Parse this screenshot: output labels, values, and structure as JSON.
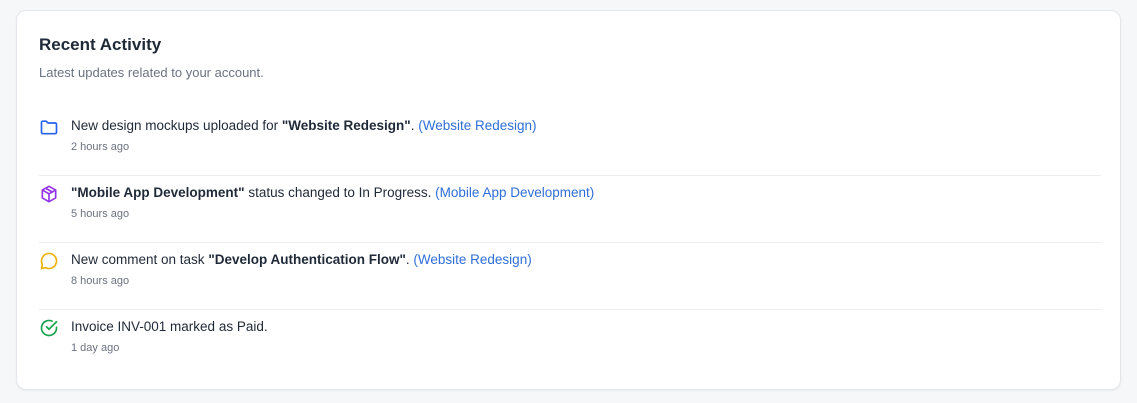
{
  "card": {
    "title": "Recent Activity",
    "subtitle": "Latest updates related to your account."
  },
  "activities": [
    {
      "icon": "folder-icon",
      "icon_color": "#2563eb",
      "prefix": "New design mockups uploaded for ",
      "bold": "\"Website Redesign\"",
      "suffix": ". ",
      "link": "(Website Redesign)",
      "time": "2 hours ago"
    },
    {
      "icon": "package-icon",
      "icon_color": "#9333ea",
      "prefix": "",
      "bold": "\"Mobile App Development\"",
      "suffix": " status changed to In Progress. ",
      "link": "(Mobile App Development)",
      "time": "5 hours ago"
    },
    {
      "icon": "comment-icon",
      "icon_color": "#eab308",
      "prefix": "New comment on task ",
      "bold": "\"Develop Authentication Flow\"",
      "suffix": ". ",
      "link": "(Website Redesign)",
      "time": "8 hours ago"
    },
    {
      "icon": "check-circle-icon",
      "icon_color": "#16a34a",
      "prefix": "Invoice INV-001 marked as Paid.",
      "bold": "",
      "suffix": "",
      "link": "",
      "time": "1 day ago"
    }
  ]
}
